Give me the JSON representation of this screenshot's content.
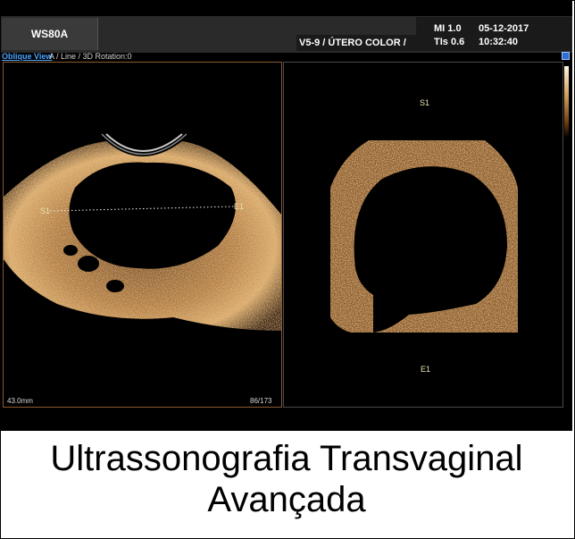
{
  "header": {
    "device": "WS80A",
    "preset": "V5-9 / ÚTERO COLOR /",
    "mi": "MI  1.0",
    "tis": "TIs 0.6",
    "date": "05-12-2017",
    "time": "10:32:40"
  },
  "viewbar": {
    "mode_link": "Oblique View",
    "details": "A / Line / 3D Rotation:0"
  },
  "left_panel": {
    "depth": "43.0mm",
    "frame": "86/173",
    "start_marker": "S1",
    "end_marker": "E1"
  },
  "right_panel": {
    "start_marker": "S1",
    "end_marker": "E1"
  },
  "colors": {
    "tissue": "#d4a060",
    "link": "#4aa3ff"
  },
  "caption": {
    "line1": "Ultrassonografia Transvaginal",
    "line2": "Avançada"
  }
}
